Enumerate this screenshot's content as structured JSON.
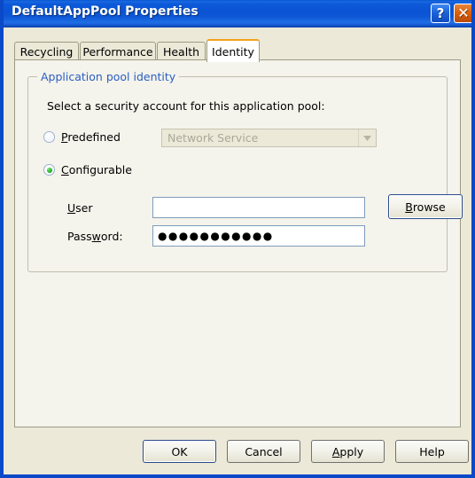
{
  "window": {
    "title": "DefaultAppPool Properties",
    "help_button": "?",
    "close_button": "✕",
    "help_icon_name": "question-mark-icon",
    "close_icon_name": "close-x-icon",
    "titlebar_color": "#0a53d4",
    "face_color": "#ece9d8"
  },
  "tabs": [
    {
      "label": "Recycling",
      "active": false
    },
    {
      "label": "Performance",
      "active": false
    },
    {
      "label": "Health",
      "active": false
    },
    {
      "label": "Identity",
      "active": true
    }
  ],
  "active_tab_accent": "#f4a11e",
  "panel": {
    "group_title": "Application pool identity",
    "group_title_color": "#2a5fc0",
    "instruction": "Select a security account for this application pool:",
    "options": {
      "predefined": {
        "label_prefix": "",
        "label_accel": "P",
        "label_rest": "redefined",
        "selected": false,
        "combo": {
          "value": "Network Service",
          "enabled": false,
          "arrow_icon": "chevron-down-icon"
        }
      },
      "configurable": {
        "label_accel": "C",
        "label_rest": "onfigurable",
        "selected": true,
        "selected_color": "#28b828"
      }
    },
    "fields": {
      "user": {
        "label_accel": "U",
        "label_rest": "ser",
        "value": "",
        "placeholder": ""
      },
      "password": {
        "label_pre": "Pass",
        "label_accel": "w",
        "label_post": "ord:",
        "value": "●●●●●●●●●●●",
        "masked": true,
        "char_count": 11
      }
    },
    "browse_button": {
      "accel": "B",
      "rest": "rowse",
      "is_default": true
    }
  },
  "actions": [
    {
      "label": "OK",
      "accel": "",
      "rest": "OK",
      "default": true
    },
    {
      "label": "Cancel",
      "accel": "",
      "rest": "Cancel",
      "default": false
    },
    {
      "label": "Apply",
      "accel": "A",
      "rest": "pply",
      "default": false
    },
    {
      "label": "Help",
      "accel": "",
      "rest": "Help",
      "default": false
    }
  ]
}
